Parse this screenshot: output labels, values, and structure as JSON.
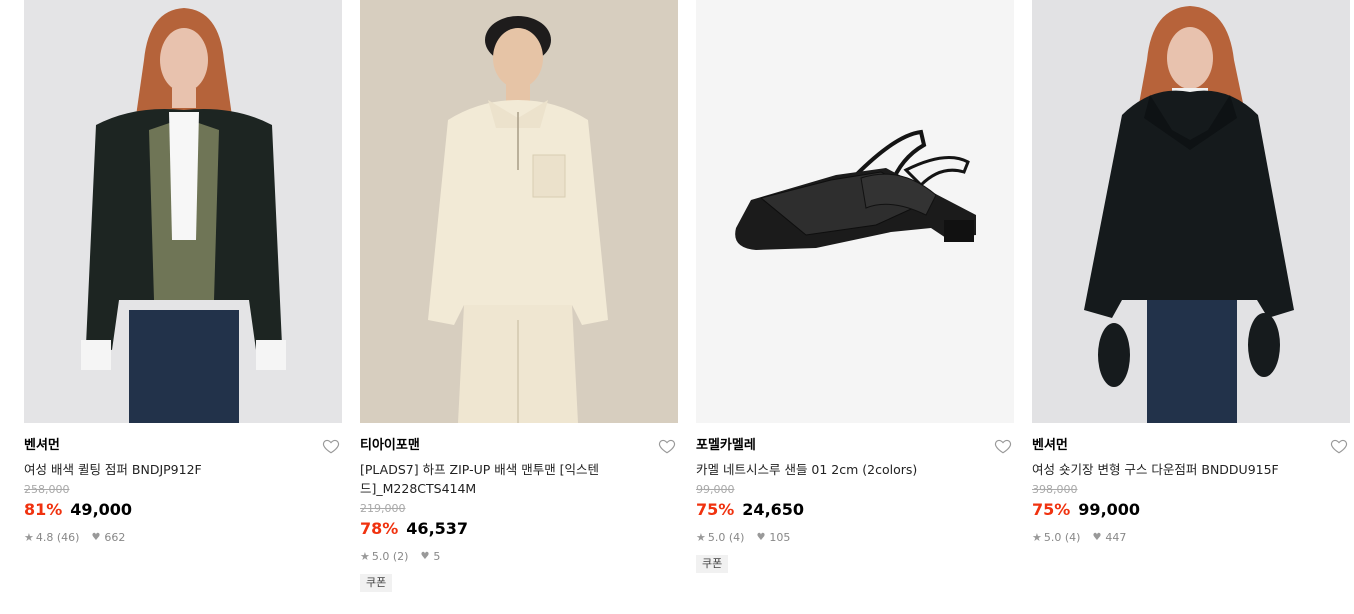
{
  "products": [
    {
      "brand": "벤셔먼",
      "name": "여성 배색 퀼팅 점퍼 BNDJP912F",
      "original_price": "258,000",
      "discount": "81%",
      "price": "49,000",
      "rating": "4.8 (46)",
      "likes": "662",
      "coupon": ""
    },
    {
      "brand": "티아이포맨",
      "name": "[PLADS7] 하프 ZIP-UP 배색 맨투맨 [익스텐드]_M228CTS414M",
      "original_price": "219,000",
      "discount": "78%",
      "price": "46,537",
      "rating": "5.0 (2)",
      "likes": "5",
      "coupon": "쿠폰"
    },
    {
      "brand": "포멜카멜레",
      "name": "카멜 네트시스루 샌들 01 2cm (2colors)",
      "original_price": "99,000",
      "discount": "75%",
      "price": "24,650",
      "rating": "5.0 (4)",
      "likes": "105",
      "coupon": "쿠폰"
    },
    {
      "brand": "벤셔먼",
      "name": "여성 숏기장 변형 구스 다운점퍼 BNDDU915F",
      "original_price": "398,000",
      "discount": "75%",
      "price": "99,000",
      "rating": "5.0 (4)",
      "likes": "447",
      "coupon": ""
    }
  ],
  "colors": {
    "discount": "#f0320f",
    "muted": "#888888"
  },
  "icons": {
    "wishlist": "heart-outline-icon",
    "rating": "star-icon",
    "likes": "heart-icon"
  }
}
